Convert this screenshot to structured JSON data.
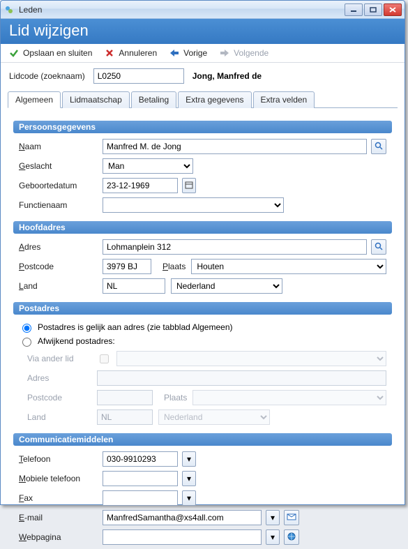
{
  "window": {
    "title": "Leden"
  },
  "header": {
    "title": "Lid wijzigen"
  },
  "toolbar": {
    "save": "Opslaan en sluiten",
    "cancel": "Annuleren",
    "prev": "Vorige",
    "next": "Volgende"
  },
  "lidcode": {
    "label": "Lidcode (zoeknaam)",
    "value": "L0250",
    "display_name": "Jong, Manfred de"
  },
  "tabs": [
    "Algemeen",
    "Lidmaatschap",
    "Betaling",
    "Extra gegevens",
    "Extra velden"
  ],
  "sections": {
    "persoon": {
      "title": "Persoonsgegevens",
      "naam_label": "Naam",
      "naam_value": "Manfred M. de Jong",
      "geslacht_label": "Geslacht",
      "geslacht_value": "Man",
      "geboorte_label": "Geboortedatum",
      "geboorte_value": "23-12-1969",
      "functie_label": "Functienaam",
      "functie_value": ""
    },
    "hoofdadres": {
      "title": "Hoofdadres",
      "adres_label": "Adres",
      "adres_value": "Lohmanplein 312",
      "postcode_label": "Postcode",
      "postcode_value": "3979 BJ",
      "plaats_label": "Plaats",
      "plaats_value": "Houten",
      "land_label": "Land",
      "land_code": "NL",
      "land_naam": "Nederland"
    },
    "postadres": {
      "title": "Postadres",
      "opt_same": "Postadres is gelijk aan adres (zie tabblad Algemeen)",
      "opt_diff": "Afwijkend postadres:",
      "via_label": "Via ander lid",
      "adres_label": "Adres",
      "postcode_label": "Postcode",
      "plaats_label": "Plaats",
      "land_label": "Land",
      "land_code": "NL",
      "land_naam": "Nederland"
    },
    "comm": {
      "title": "Communicatiemiddelen",
      "telefoon_label": "Telefoon",
      "telefoon_value": "030-9910293",
      "mobiel_label": "Mobiele telefoon",
      "mobiel_value": "",
      "fax_label": "Fax",
      "fax_value": "",
      "email_label": "E-mail",
      "email_value": "ManfredSamantha@xs4all.com",
      "web_label": "Webpagina",
      "web_value": ""
    }
  }
}
